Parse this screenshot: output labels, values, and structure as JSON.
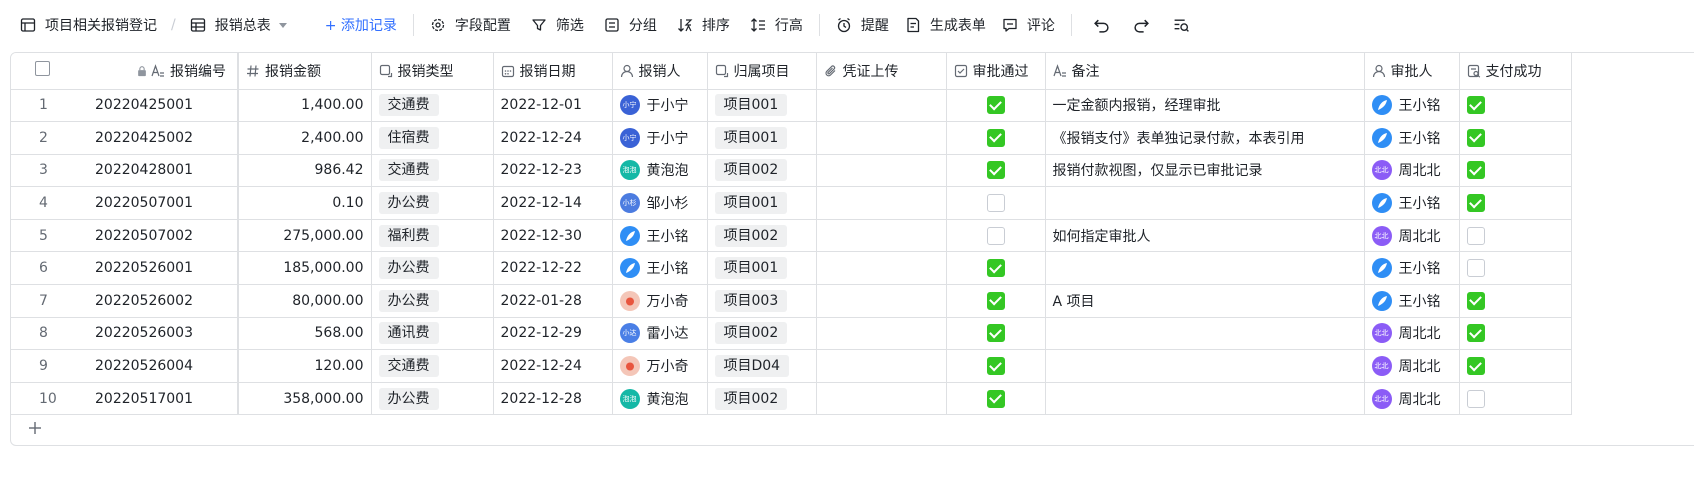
{
  "toolbar": {
    "doc_title": "项目相关报销登记",
    "view_name": "报销总表",
    "add_record": "+ 添加记录",
    "field_config": "字段配置",
    "filter": "筛选",
    "group": "分组",
    "sort": "排序",
    "row_height": "行高",
    "remind": "提醒",
    "generate_form": "生成表单",
    "comment": "评论"
  },
  "columns": {
    "code": "报销编号",
    "amount": "报销金额",
    "type": "报销类型",
    "date": "报销日期",
    "person": "报销人",
    "project": "归属项目",
    "voucher": "凭证上传",
    "approved": "审批通过",
    "note": "备注",
    "approver": "审批人",
    "paid": "支付成功"
  },
  "avatars": {
    "yxn": {
      "text": "小宁",
      "color": "#3a62d6"
    },
    "hpp": {
      "text": "泡泡",
      "color": "#14b8a6"
    },
    "zxs": {
      "text": "小杉",
      "color": "#4c7ce0"
    },
    "wxm": {
      "text": "",
      "color": "#2f8ef5"
    },
    "wxq": {
      "text": "",
      "color": "#f4c6b8"
    },
    "lxd": {
      "text": "小达",
      "color": "#4a7fe6"
    },
    "zbb": {
      "text": "北北",
      "color": "#8b5cf6"
    }
  },
  "rows": [
    {
      "idx": "1",
      "code": "20220425001",
      "amount": "1,400.00",
      "type": "交通费",
      "date": "2022-12-01",
      "person": "于小宁",
      "person_av": "yxn",
      "project": "项目001",
      "approved": true,
      "note": "一定金额内报销，经理审批",
      "approver": "王小铭",
      "approver_av": "wxm",
      "paid": true
    },
    {
      "idx": "2",
      "code": "20220425002",
      "amount": "2,400.00",
      "type": "住宿费",
      "date": "2022-12-24",
      "person": "于小宁",
      "person_av": "yxn",
      "project": "项目001",
      "approved": true,
      "note": "《报销支付》表单独记录付款，本表引用",
      "approver": "王小铭",
      "approver_av": "wxm",
      "paid": true
    },
    {
      "idx": "3",
      "code": "20220428001",
      "amount": "986.42",
      "type": "交通费",
      "date": "2022-12-23",
      "person": "黄泡泡",
      "person_av": "hpp",
      "project": "项目002",
      "approved": true,
      "note": "报销付款视图，仅显示已审批记录",
      "approver": "周北北",
      "approver_av": "zbb",
      "paid": true
    },
    {
      "idx": "4",
      "code": "20220507001",
      "amount": "0.10",
      "type": "办公费",
      "date": "2022-12-14",
      "person": "邹小杉",
      "person_av": "zxs",
      "project": "项目001",
      "approved": false,
      "note": "",
      "approver": "王小铭",
      "approver_av": "wxm",
      "paid": true
    },
    {
      "idx": "5",
      "code": "20220507002",
      "amount": "275,000.00",
      "type": "福利费",
      "date": "2022-12-30",
      "person": "王小铭",
      "person_av": "wxm",
      "project": "项目002",
      "approved": false,
      "note": "如何指定审批人",
      "approver": "周北北",
      "approver_av": "zbb",
      "paid": false
    },
    {
      "idx": "6",
      "code": "20220526001",
      "amount": "185,000.00",
      "type": "办公费",
      "date": "2022-12-22",
      "person": "王小铭",
      "person_av": "wxm",
      "project": "项目001",
      "approved": true,
      "note": "",
      "approver": "王小铭",
      "approver_av": "wxm",
      "paid": false
    },
    {
      "idx": "7",
      "code": "20220526002",
      "amount": "80,000.00",
      "type": "办公费",
      "date": "2022-01-28",
      "person": "万小奇",
      "person_av": "wxq",
      "project": "项目003",
      "approved": true,
      "note": "A 项目",
      "approver": "王小铭",
      "approver_av": "wxm",
      "paid": true
    },
    {
      "idx": "8",
      "code": "20220526003",
      "amount": "568.00",
      "type": "通讯费",
      "date": "2022-12-29",
      "person": "雷小达",
      "person_av": "lxd",
      "project": "项目002",
      "approved": true,
      "note": "",
      "approver": "周北北",
      "approver_av": "zbb",
      "paid": true
    },
    {
      "idx": "9",
      "code": "20220526004",
      "amount": "120.00",
      "type": "交通费",
      "date": "2022-12-24",
      "person": "万小奇",
      "person_av": "wxq",
      "project": "项目D04",
      "approved": true,
      "note": "",
      "approver": "周北北",
      "approver_av": "zbb",
      "paid": true
    },
    {
      "idx": "10",
      "code": "20220517001",
      "amount": "358,000.00",
      "type": "办公费",
      "date": "2022-12-28",
      "person": "黄泡泡",
      "person_av": "hpp",
      "project": "项目002",
      "approved": true,
      "note": "",
      "approver": "周北北",
      "approver_av": "zbb",
      "paid": false
    }
  ]
}
